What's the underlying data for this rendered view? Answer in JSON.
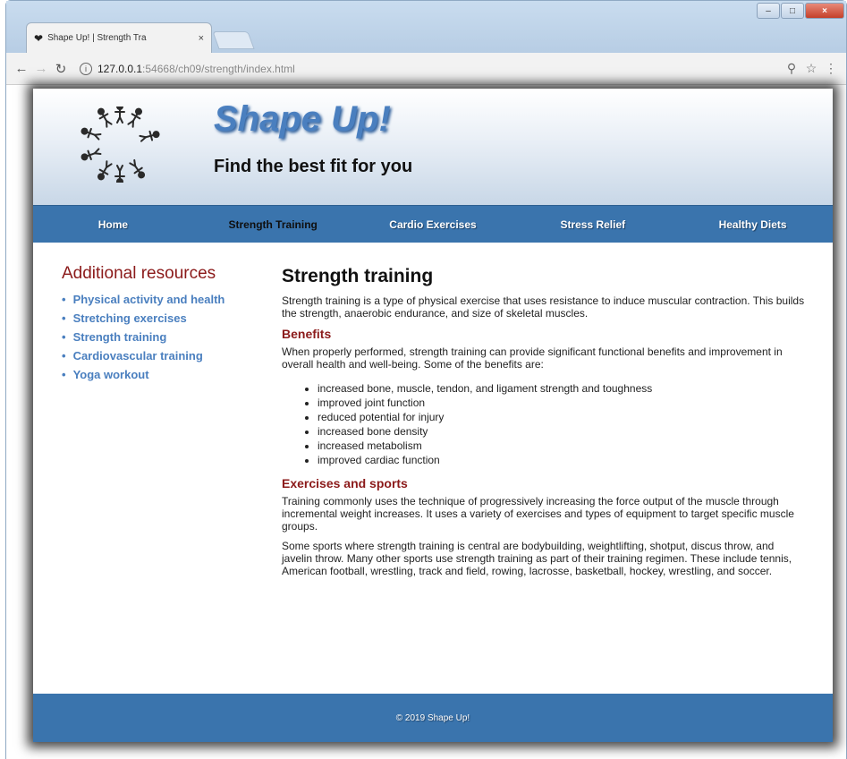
{
  "browser": {
    "tab_title": "Shape Up! | Strength Tra",
    "tab_close": "×",
    "url_host": "127.0.0.1",
    "url_path": ":54668/ch09/strength/index.html",
    "window_buttons": {
      "minimize": "–",
      "maximize": "□",
      "close": "×"
    }
  },
  "header": {
    "title": "Shape Up!",
    "tagline": "Find the best fit for you"
  },
  "nav": {
    "items": [
      {
        "label": "Home"
      },
      {
        "label": "Strength Training"
      },
      {
        "label": "Cardio Exercises"
      },
      {
        "label": "Stress Relief"
      },
      {
        "label": "Healthy Diets"
      }
    ]
  },
  "aside": {
    "heading": "Additional resources",
    "links": [
      {
        "label": "Physical activity and health"
      },
      {
        "label": "Stretching exercises"
      },
      {
        "label": "Strength training"
      },
      {
        "label": "Cardiovascular training"
      },
      {
        "label": "Yoga workout"
      }
    ]
  },
  "main": {
    "heading": "Strength training",
    "intro": "Strength training is a type of physical exercise that uses resistance to induce muscular contraction. This builds the strength, anaerobic endurance, and size of skeletal muscles.",
    "benefits_heading": "Benefits",
    "benefits_intro": "When properly performed, strength training can provide significant functional benefits and improvement in overall health and well-being. Some of the benefits are:",
    "benefits": [
      "increased bone, muscle, tendon, and ligament strength and toughness",
      "improved joint function",
      "reduced potential for injury",
      "increased bone density",
      "increased metabolism",
      "improved cardiac function"
    ],
    "exercises_heading": "Exercises and sports",
    "exercises_p1": "Training commonly uses the technique of progressively increasing the force output of the muscle through incremental weight increases. It uses a variety of exercises and types of equipment to target specific muscle groups.",
    "exercises_p2": "Some sports where strength training is central are bodybuilding, weightlifting, shotput, discus throw, and javelin throw. Many other sports use strength training as part of their training regimen. These include tennis, American football, wrestling, track and field, rowing, lacrosse, basketball, hockey, wrestling, and soccer."
  },
  "footer": {
    "text": "© 2019 Shape Up!"
  },
  "colors": {
    "brand_blue": "#3a74ad",
    "title_blue": "#4a7fbf",
    "accent_red": "#8b1a1a"
  }
}
